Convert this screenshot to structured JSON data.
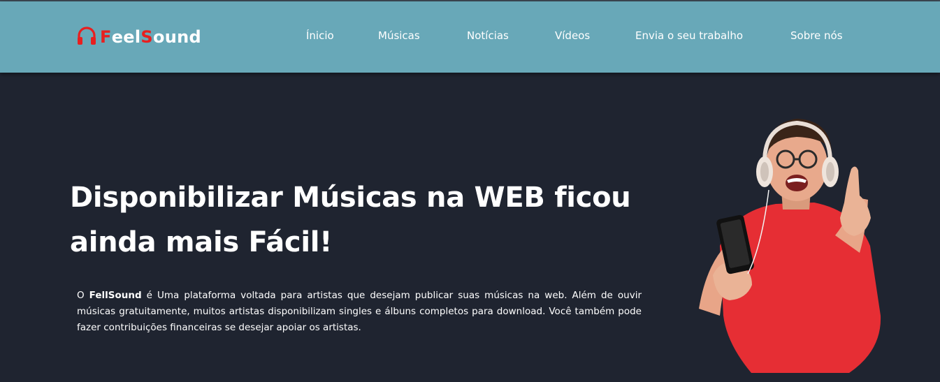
{
  "brand": {
    "logo_letters": [
      {
        "ch": "F",
        "accent": true
      },
      {
        "ch": "eel",
        "accent": false
      },
      {
        "ch": "S",
        "accent": true
      },
      {
        "ch": "ound",
        "accent": false
      }
    ],
    "accent_color": "#e81f1f",
    "header_color": "#68a8b8",
    "background_color": "#1f2430"
  },
  "nav": {
    "items": [
      {
        "label": "Ínicio"
      },
      {
        "label": "Músicas"
      },
      {
        "label": "Notícias"
      },
      {
        "label": "Vídeos"
      },
      {
        "label": "Envia o seu trabalho"
      },
      {
        "label": "Sobre nós"
      }
    ]
  },
  "hero": {
    "title_line1": "Disponibilizar Músicas na WEB ficou",
    "title_line2": "ainda mais Fácil!",
    "desc_prefix": "O ",
    "desc_brand": "FellSound",
    "desc_rest": " é Uma plataforma voltada para artistas que desejam publicar suas músicas na web. Além de ouvir músicas gratuitamente, muitos artistas disponibilizam singles e álbuns completos para download. Você também pode fazer contribuições financeiras se desejar apoiar os artistas.",
    "image_icon": "man-with-headphones-and-phone"
  }
}
